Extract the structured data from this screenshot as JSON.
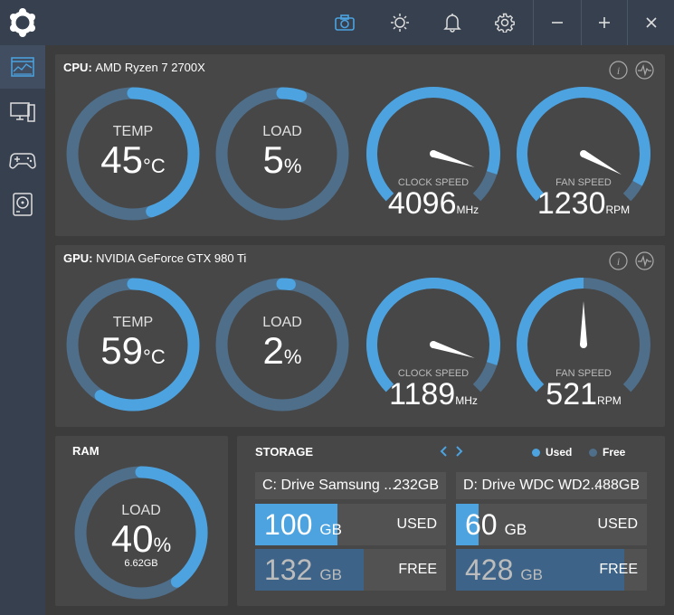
{
  "colors": {
    "accent": "#4ca3e0",
    "track": "#4f6e8a",
    "panel": "#474747",
    "bar_used": "#4ca3e0",
    "bar_free": "#3d6488"
  },
  "titlebar": {
    "icons": [
      "camera-icon",
      "brightness-icon",
      "bell-icon",
      "gear-icon",
      "minimize-icon",
      "maximize-icon",
      "close-icon"
    ],
    "active_icon": "camera-icon"
  },
  "sidebar": {
    "items": [
      "monitor-dashboard-icon",
      "desktop-icon",
      "gamepad-icon",
      "disk-icon"
    ],
    "active_index": 0
  },
  "cpu": {
    "label": "CPU:",
    "name": "AMD Ryzen 7 2700X",
    "temp": {
      "label": "TEMP",
      "value": "45",
      "unit": "°C",
      "percent": 45
    },
    "load": {
      "label": "LOAD",
      "value": "5",
      "unit": "%",
      "percent": 5
    },
    "clock": {
      "label": "CLOCK SPEED",
      "value": "4096",
      "unit": "MHz",
      "fraction": 0.9
    },
    "fan": {
      "label": "FAN SPEED",
      "value": "1230",
      "unit": "RPM",
      "fraction": 0.94
    }
  },
  "gpu": {
    "label": "GPU:",
    "name": "NVIDIA GeForce GTX 980 Ti",
    "temp": {
      "label": "TEMP",
      "value": "59",
      "unit": "°C",
      "percent": 59
    },
    "load": {
      "label": "LOAD",
      "value": "2",
      "unit": "%",
      "percent": 2
    },
    "clock": {
      "label": "CLOCK SPEED",
      "value": "1189",
      "unit": "MHz",
      "fraction": 0.9
    },
    "fan": {
      "label": "FAN SPEED",
      "value": "521",
      "unit": "RPM",
      "fraction": 0.5
    }
  },
  "ram": {
    "title": "RAM",
    "label": "LOAD",
    "value": "40",
    "unit": "%",
    "used": "6.62GB",
    "percent": 40
  },
  "storage": {
    "title": "STORAGE",
    "legend_used": "Used",
    "legend_free": "Free",
    "drives": [
      {
        "name": "C: Drive Samsung ...",
        "size": "232GB",
        "used_value": "100",
        "used_unit": "GB",
        "used_tag": "USED",
        "used_fraction": 0.43,
        "free_value": "132",
        "free_unit": "GB",
        "free_tag": "FREE",
        "free_fraction": 0.57
      },
      {
        "name": "D: Drive WDC WD2...",
        "size": "488GB",
        "used_value": "60",
        "used_unit": "GB",
        "used_tag": "USED",
        "used_fraction": 0.12,
        "free_value": "428",
        "free_unit": "GB",
        "free_tag": "FREE",
        "free_fraction": 0.88
      }
    ]
  }
}
